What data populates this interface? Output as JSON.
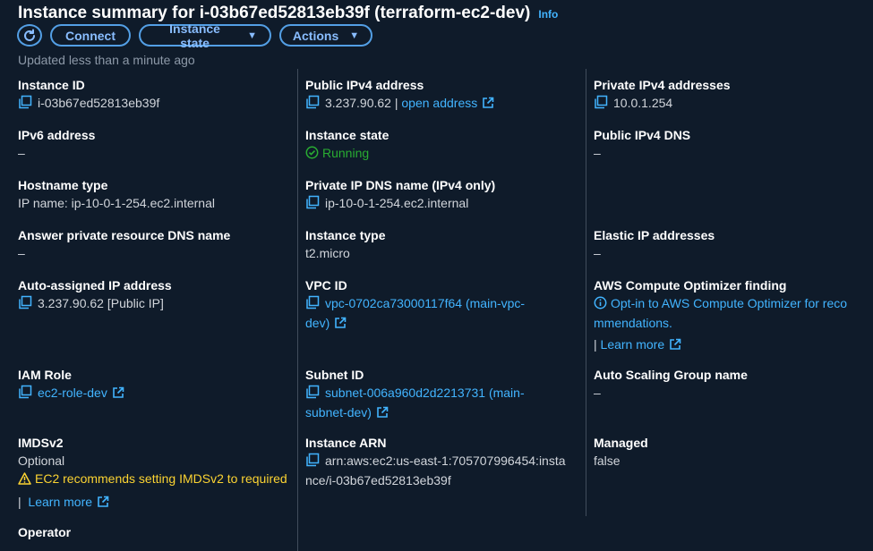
{
  "header": {
    "title": "Instance summary for i-03b67ed52813eb39f (terraform-ec2-dev)",
    "info": "Info",
    "updated": "Updated less than a minute ago"
  },
  "buttons": {
    "connect": "Connect",
    "instance_state": "Instance state",
    "actions": "Actions"
  },
  "col1": {
    "instance_id": {
      "label": "Instance ID",
      "value": "i-03b67ed52813eb39f"
    },
    "ipv6": {
      "label": "IPv6 address",
      "value": "–"
    },
    "hostname_type": {
      "label": "Hostname type",
      "value": "IP name: ip-10-0-1-254.ec2.internal"
    },
    "answer_dns": {
      "label": "Answer private resource DNS name",
      "value": "–"
    },
    "auto_ip": {
      "label": "Auto-assigned IP address",
      "value": "3.237.90.62 [Public IP]"
    },
    "iam_role": {
      "label": "IAM Role",
      "value": "ec2-role-dev"
    },
    "imdsv2": {
      "label": "IMDSv2",
      "value": "Optional",
      "warning": "EC2 recommends setting IMDSv2 to required",
      "learn_more": "Learn more"
    },
    "operator": {
      "label": "Operator"
    }
  },
  "col2": {
    "public_ipv4": {
      "label": "Public IPv4 address",
      "value": "3.237.90.62",
      "open": "open address"
    },
    "instance_state": {
      "label": "Instance state",
      "value": "Running"
    },
    "private_dns": {
      "label": "Private IP DNS name (IPv4 only)",
      "value": "ip-10-0-1-254.ec2.internal"
    },
    "instance_type": {
      "label": "Instance type",
      "value": "t2.micro"
    },
    "vpc": {
      "label": "VPC ID",
      "value_1": "vpc-0702ca73000117f64 (main-vpc-",
      "value_2": "dev)"
    },
    "subnet": {
      "label": "Subnet ID",
      "value_1": "subnet-006a960d2d2213731 (main-",
      "value_2": "subnet-dev)"
    },
    "arn": {
      "label": "Instance ARN",
      "value_1": "arn:aws:ec2:us-east-1:705707996454:insta",
      "value_2": "nce/i-03b67ed52813eb39f"
    }
  },
  "col3": {
    "private_ipv4": {
      "label": "Private IPv4 addresses",
      "value": "10.0.1.254"
    },
    "public_dns": {
      "label": "Public IPv4 DNS",
      "value": "–"
    },
    "elastic_ip": {
      "label": "Elastic IP addresses",
      "value": "–"
    },
    "optimizer": {
      "label": "AWS Compute Optimizer finding",
      "value_1": "Opt-in to AWS Compute Optimizer for reco",
      "value_2": "mmendations.",
      "learn_more": "Learn more"
    },
    "asg": {
      "label": "Auto Scaling Group name",
      "value": "–"
    },
    "managed": {
      "label": "Managed",
      "value": "false"
    }
  },
  "icons": {
    "copy": "copy-icon",
    "external": "external-link-icon",
    "refresh": "refresh-icon",
    "check": "check-circle-icon",
    "warning": "warning-icon",
    "info": "info-circle-icon",
    "caret": "caret-down-icon"
  },
  "colors": {
    "background": "#0f1b2a",
    "link": "#42b4ff",
    "running": "#29ad32",
    "warning": "#fbd332",
    "divider": "#414d5c"
  }
}
